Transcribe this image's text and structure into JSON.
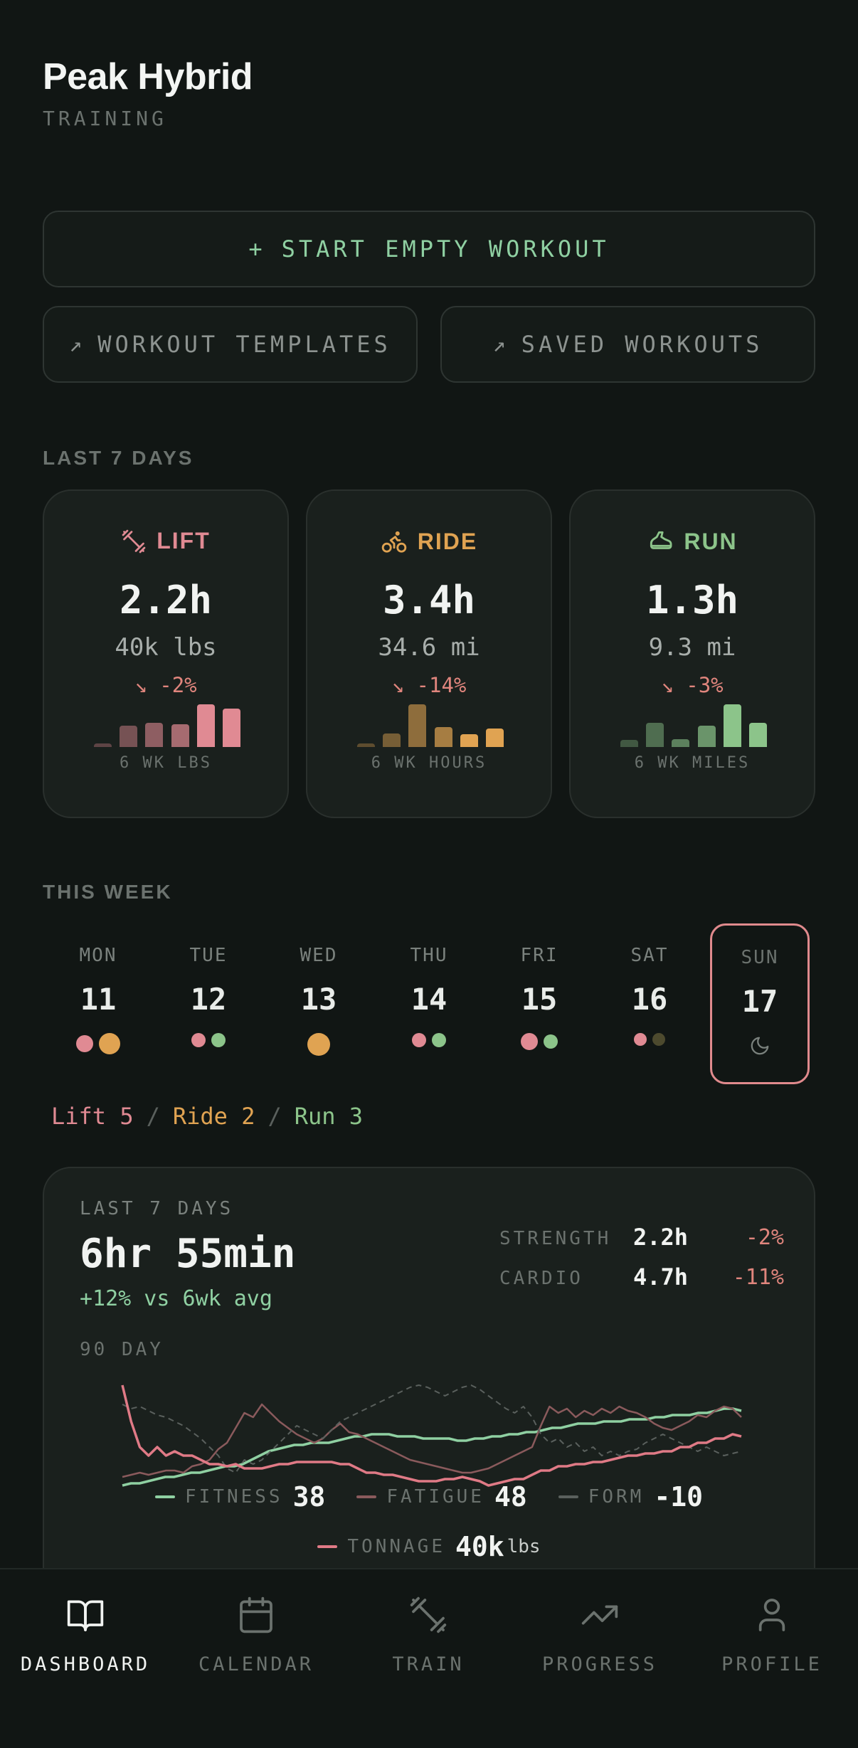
{
  "app": {
    "title": "Peak Hybrid",
    "subtitle": "TRAINING"
  },
  "actions": {
    "start_label": "START EMPTY WORKOUT",
    "start_prefix": "+",
    "templates_label": "WORKOUT TEMPLATES",
    "saved_label": "SAVED WORKOUTS",
    "arrow": "↗"
  },
  "last7": {
    "label": "LAST 7 DAYS",
    "cards": [
      {
        "name": "LIFT",
        "icon": "dumbbell-icon",
        "color": "#e08a93",
        "hours": "2.2h",
        "volume": "40k lbs",
        "delta": "-2%",
        "trend_icon": "↘",
        "footer": "6 WK LBS",
        "bars": [
          0.06,
          0.38,
          0.42,
          0.4,
          0.75,
          0.67
        ]
      },
      {
        "name": "RIDE",
        "icon": "bike-icon",
        "color": "#e0a352",
        "hours": "3.4h",
        "volume": "34.6 mi",
        "delta": "-14%",
        "trend_icon": "↘",
        "footer": "6 WK HOURS",
        "bars": [
          0.06,
          0.24,
          0.75,
          0.35,
          0.22,
          0.32
        ]
      },
      {
        "name": "RUN",
        "icon": "shoe-icon",
        "color": "#8cc48a",
        "hours": "1.3h",
        "volume": "9.3 mi",
        "delta": "-3%",
        "trend_icon": "↘",
        "footer": "6 WK MILES",
        "bars": [
          0.12,
          0.42,
          0.14,
          0.38,
          0.75,
          0.42
        ]
      }
    ]
  },
  "week": {
    "label": "THIS WEEK",
    "days": [
      {
        "name": "MON",
        "num": "11",
        "dots": [
          [
            "#e08a93",
            24
          ],
          [
            "#e0a352",
            30
          ]
        ]
      },
      {
        "name": "TUE",
        "num": "12",
        "dots": [
          [
            "#e08a93",
            20
          ],
          [
            "#8cc48a",
            20
          ]
        ]
      },
      {
        "name": "WED",
        "num": "13",
        "dots": [
          [
            "#e0a352",
            32
          ]
        ]
      },
      {
        "name": "THU",
        "num": "14",
        "dots": [
          [
            "#e08a93",
            20
          ],
          [
            "#8cc48a",
            20
          ]
        ]
      },
      {
        "name": "FRI",
        "num": "15",
        "dots": [
          [
            "#e08a93",
            24
          ],
          [
            "#8cc48a",
            20
          ]
        ]
      },
      {
        "name": "SAT",
        "num": "16",
        "dots": [
          [
            "#e08a93",
            18
          ],
          [
            "#4d4a2e",
            18
          ]
        ]
      },
      {
        "name": "SUN",
        "num": "17",
        "today": true,
        "rest_icon": "moon-icon"
      }
    ],
    "summary": {
      "lift": "Lift 5",
      "ride": "Ride 2",
      "run": "Run 3",
      "sep": "/"
    }
  },
  "load": {
    "label": "LAST 7 DAYS",
    "total": "6hr 55min",
    "vs_avg": "+12% vs 6wk avg",
    "strength": {
      "label": "STRENGTH",
      "value": "2.2h",
      "delta": "-2%"
    },
    "cardio": {
      "label": "CARDIO",
      "value": "4.7h",
      "delta": "-11%"
    },
    "period_label": "90 DAY",
    "legend": {
      "fitness": {
        "label": "FITNESS",
        "value": "38",
        "color": "#8fd0a2"
      },
      "fatigue": {
        "label": "FATIGUE",
        "value": "48",
        "color": "#8a5a5c"
      },
      "form": {
        "label": "FORM",
        "value": "-10",
        "color": "#5a605d"
      },
      "tonnage": {
        "label": "TONNAGE",
        "value": "40k",
        "unit": "lbs",
        "color": "#e07a86"
      }
    }
  },
  "chart_data": {
    "type": "line",
    "title": "90 DAY",
    "series": [
      {
        "name": "FITNESS",
        "color": "#8fd0a2",
        "values": [
          8,
          9,
          9,
          10,
          11,
          12,
          12,
          13,
          14,
          14,
          15,
          16,
          17,
          17,
          18,
          20,
          22,
          24,
          25,
          26,
          27,
          27,
          28,
          28,
          28,
          29,
          30,
          31,
          31,
          32,
          32,
          32,
          31,
          31,
          31,
          30,
          30,
          30,
          30,
          29,
          29,
          30,
          30,
          31,
          31,
          32,
          32,
          33,
          33,
          34,
          35,
          35,
          36,
          37,
          37,
          37,
          38,
          38,
          38,
          39,
          39,
          39,
          40,
          40,
          41,
          41,
          41,
          42,
          42,
          43,
          44,
          44,
          43
        ]
      },
      {
        "name": "FATIGUE",
        "color": "#8a5a5c",
        "values": [
          12,
          13,
          14,
          13,
          14,
          15,
          15,
          14,
          17,
          18,
          20,
          25,
          28,
          35,
          42,
          40,
          46,
          42,
          38,
          35,
          32,
          30,
          28,
          30,
          34,
          37,
          33,
          32,
          30,
          28,
          26,
          24,
          22,
          20,
          19,
          18,
          17,
          16,
          15,
          14,
          14,
          15,
          16,
          18,
          20,
          22,
          24,
          26,
          36,
          45,
          42,
          44,
          40,
          43,
          41,
          44,
          42,
          45,
          43,
          42,
          40,
          37,
          35,
          34,
          36,
          38,
          41,
          40,
          43,
          45,
          44,
          40
        ]
      },
      {
        "name": "FORM",
        "color": "#5a605d",
        "values": [
          46,
          44,
          45,
          43,
          41,
          40,
          38,
          36,
          33,
          30,
          26,
          22,
          16,
          14,
          20,
          18,
          20,
          24,
          28,
          32,
          36,
          34,
          32,
          30,
          34,
          38,
          40,
          42,
          44,
          46,
          48,
          50,
          52,
          54,
          55,
          54,
          52,
          50,
          52,
          54,
          55,
          53,
          50,
          47,
          44,
          42,
          45,
          40,
          32,
          28,
          30,
          26,
          28,
          24,
          26,
          22,
          24,
          22,
          24,
          25,
          28,
          30,
          32,
          30,
          28,
          26,
          24,
          26,
          24,
          22,
          23,
          24
        ]
      },
      {
        "name": "TONNAGE",
        "color": "#e07a86",
        "values": [
          55,
          38,
          26,
          22,
          26,
          22,
          24,
          22,
          22,
          20,
          18,
          18,
          17,
          18,
          16,
          16,
          16,
          17,
          18,
          18,
          19,
          19,
          19,
          19,
          19,
          18,
          18,
          16,
          14,
          14,
          13,
          13,
          12,
          11,
          10,
          10,
          10,
          11,
          11,
          12,
          11,
          10,
          8,
          9,
          10,
          11,
          11,
          13,
          15,
          15,
          17,
          17,
          18,
          18,
          19,
          19,
          20,
          21,
          22,
          22,
          23,
          23,
          24,
          24,
          26,
          26,
          28,
          28,
          30,
          30,
          32,
          31
        ]
      }
    ],
    "legend": [
      "FITNESS 38",
      "FATIGUE 48",
      "FORM -10",
      "TONNAGE 40k lbs"
    ],
    "grid": false,
    "ylim": [
      0,
      60
    ]
  },
  "nav": {
    "items": [
      {
        "label": "DASHBOARD",
        "icon": "book-icon",
        "active": true
      },
      {
        "label": "CALENDAR",
        "icon": "calendar-icon"
      },
      {
        "label": "TRAIN",
        "icon": "dumbbell-icon"
      },
      {
        "label": "PROGRESS",
        "icon": "trending-up-icon"
      },
      {
        "label": "PROFILE",
        "icon": "user-icon"
      }
    ]
  }
}
